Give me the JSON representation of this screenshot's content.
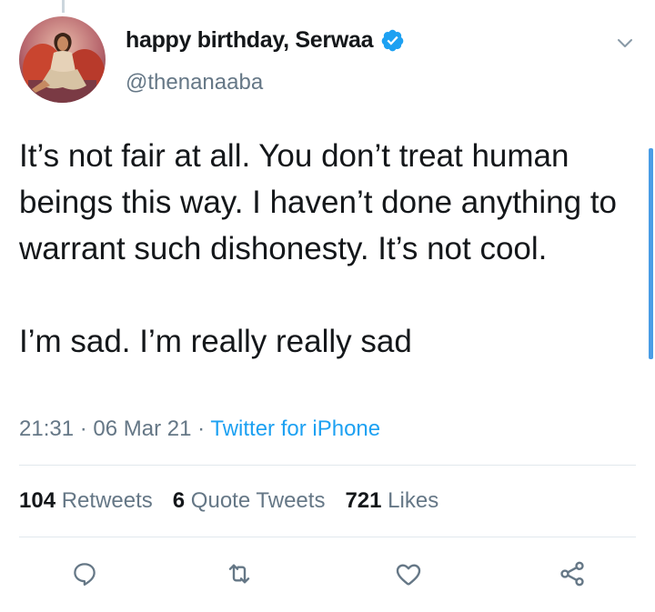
{
  "user": {
    "display_name": "happy birthday, Serwaa",
    "handle": "@thenanaaba",
    "verified": true
  },
  "tweet": {
    "paragraphs": [
      "It’s not fair at all. You don’t treat human beings this way. I haven’t done anything to warrant such dishonesty. It’s not cool.",
      "I’m sad. I’m really really sad"
    ],
    "time": "21:31",
    "separator_1": " · ",
    "date": "06 Mar 21",
    "separator_2": " · ",
    "source": "Twitter for iPhone"
  },
  "stats": {
    "retweets_count": "104",
    "retweets_label": "Retweets",
    "quotes_count": "6",
    "quotes_label": "Quote Tweets",
    "likes_count": "721",
    "likes_label": "Likes"
  },
  "actions": {
    "icons": [
      "reply-icon",
      "retweet-icon",
      "like-icon",
      "share-icon"
    ]
  },
  "colors": {
    "text": "#14171a",
    "secondary": "#657786",
    "accent": "#1da1f2",
    "divider": "#e1e8ed"
  }
}
